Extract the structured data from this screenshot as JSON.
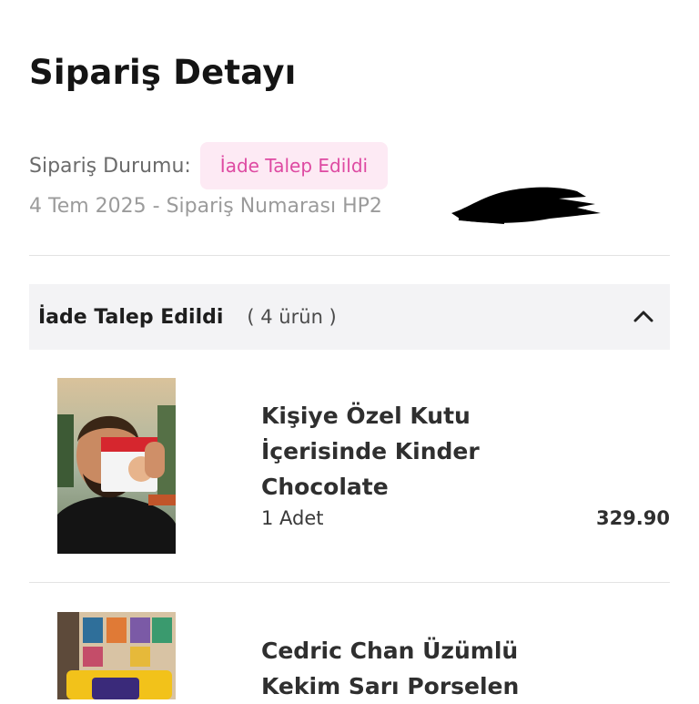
{
  "header": {
    "title": "Sipariş Detayı"
  },
  "order": {
    "status_label": "Sipariş Durumu:",
    "status_value": "İade Talep Edildi",
    "meta_text": "4 Tem 2025 - Sipariş Numarası HP2"
  },
  "group": {
    "title": "İade Talep Edildi",
    "count": "( 4 ürün )",
    "toggle_icon": "chevron-up-icon"
  },
  "items": [
    {
      "name_lines": [
        "Kişiye Özel Kutu",
        "İçerisinde Kinder",
        "Chocolate"
      ],
      "quantity": "1 Adet",
      "price": "329.90",
      "image": "photo-person-holding-kinder-chocolate"
    },
    {
      "name_lines": [
        "Cedric Chan Üzümlü",
        "Kekim Sarı Porselen"
      ],
      "image": "photo-yellow-porcelain-mug"
    }
  ],
  "colors": {
    "badge_bg": "#fdeaf4",
    "badge_text": "#de4aa2",
    "group_header_bg": "#f3f3f5",
    "divider": "#e3e3e3",
    "title_text": "#141414",
    "muted_text": "#9b9b9b"
  }
}
